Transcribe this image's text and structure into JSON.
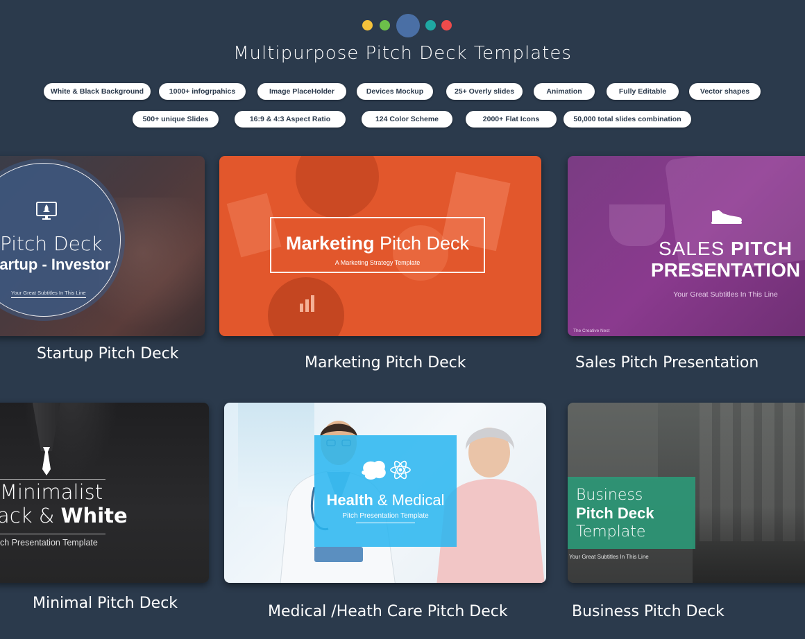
{
  "header": {
    "title": "Multipurpose Pitch Deck Templates",
    "dot_colors": [
      "#f5c23b",
      "#6cc04a",
      "#4a6fa5",
      "#1fa8a3",
      "#ee4b4b"
    ]
  },
  "features": [
    "White & Black Background",
    "1000+ infogrpahics",
    "Image PlaceHolder",
    "Devices Mockup",
    "25+ Overly slides",
    "Animation",
    "Fully Editable",
    "Vector shapes",
    "500+ unique Slides",
    "16:9 & 4:3 Aspect Ratio",
    "124 Color Scheme",
    "2000+ Flat Icons",
    "50,000 total slides combination"
  ],
  "cards": {
    "startup": {
      "line1": "Pitch Deck",
      "line2": "tartup - Investor",
      "subtitle": "Your Great Subtitles In This Line",
      "caption": "Startup Pitch Deck",
      "icon": "rocket-monitor-icon"
    },
    "marketing": {
      "title_bold": "Marketing",
      "title_light": " Pitch Deck",
      "subtitle": "A Marketing Strategy Template",
      "caption": "Marketing Pitch Deck",
      "color": "#e2572c"
    },
    "sales": {
      "line1_light": "SALES ",
      "line1_bold": "PITCH",
      "line2": "PRESENTATION",
      "subtitle": "Your Great Subtitles In This Line",
      "footer": "The Creative Nest",
      "caption": "Sales Pitch Presentation",
      "icon": "sneaker-icon",
      "color": "#8a3a8e"
    },
    "minimal": {
      "line1": "Minimalist",
      "line2_light": "ack & ",
      "line2_bold": "White",
      "subtitle": "ch Presentation Template",
      "caption": "Minimal Pitch Deck",
      "icon": "necktie-icon"
    },
    "medical": {
      "title_bold": "Health",
      "title_light": " & Medical",
      "subtitle": "Pitch Presentation Template",
      "caption": "Medical /Heath Care Pitch Deck",
      "icon": "brain-atom-icon",
      "color": "#29b6f0"
    },
    "business": {
      "line1": "Business",
      "line2": "Pitch Deck",
      "line3": "Template",
      "subtitle": "Your Great Subtitles In This Line",
      "caption": "Business Pitch Deck",
      "color": "#2a9d7a"
    }
  }
}
